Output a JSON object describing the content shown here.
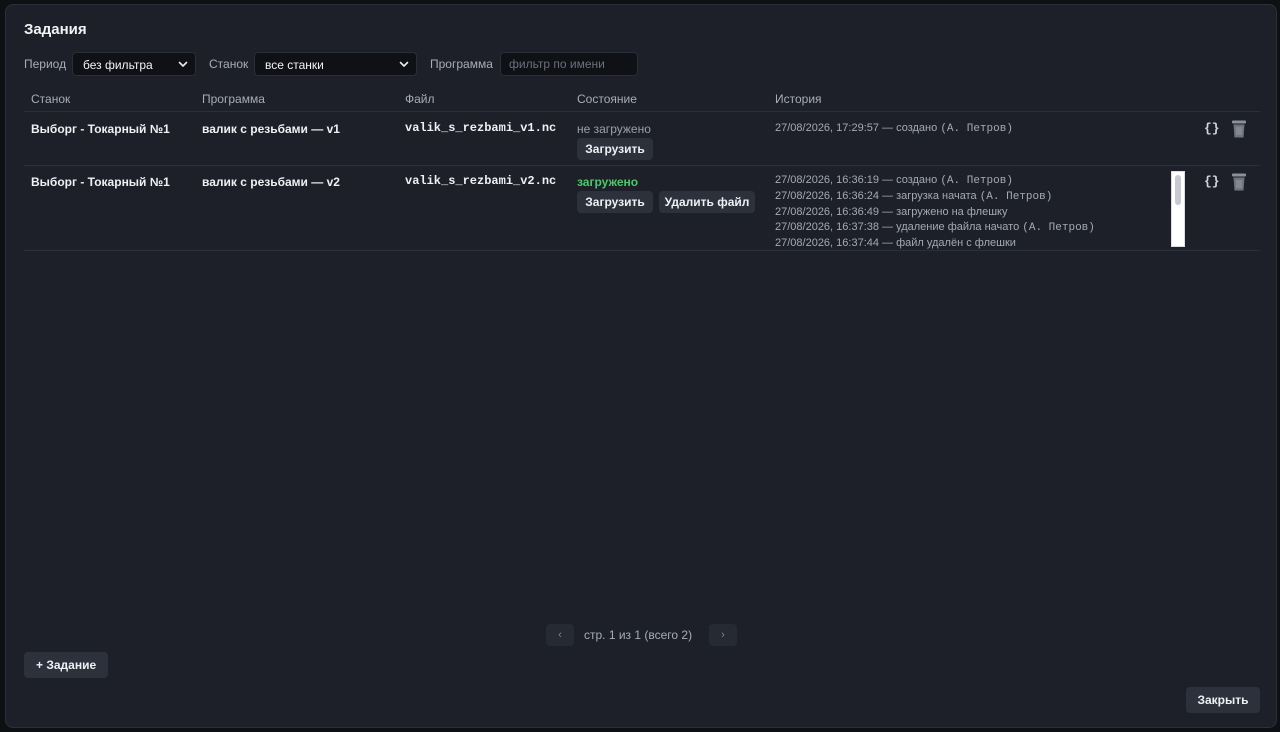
{
  "dialog": {
    "title": "Задания",
    "filters": {
      "period_label": "Период",
      "period_value": "без фильтра",
      "machine_label": "Станок",
      "machine_value": "все станки",
      "program_label": "Программа",
      "program_placeholder": "фильтр по имени",
      "program_value": ""
    },
    "columns": [
      "Станок",
      "Программа",
      "Файл",
      "Состояние",
      "История"
    ],
    "rows": [
      {
        "machine": "Выборг - Токарный №1",
        "program": "валик с резьбами — v1",
        "file": "valik_s_rezbami_v1.nc",
        "status": "не загружено",
        "buttons": [
          "Загрузить"
        ],
        "history": [
          {
            "text": "27/08/2026, 17:29:57 — создано",
            "user": "(А. Петров)"
          }
        ]
      },
      {
        "machine": "Выборг - Токарный №1",
        "program": "валик с резьбами — v2",
        "file": "valik_s_rezbami_v2.nc",
        "status": "загружено",
        "buttons": [
          "Загрузить",
          "Удалить файл"
        ],
        "history": [
          {
            "text": "27/08/2026, 16:36:19 — создано",
            "user": "(А. Петров)"
          },
          {
            "text": "27/08/2026, 16:36:24 — загрузка начата",
            "user": "(А. Петров)"
          },
          {
            "text": "27/08/2026, 16:36:49 — загружено на флешку",
            "user": ""
          },
          {
            "text": "27/08/2026, 16:37:38 — удаление файла начато",
            "user": "(А. Петров)"
          },
          {
            "text": "27/08/2026, 16:37:44 — файл удалён с флешки",
            "user": ""
          }
        ]
      }
    ],
    "row_actions": {
      "json_label": "{}"
    },
    "pagination": {
      "prev": "‹",
      "text": "стр. 1 из 1 (всего 2)",
      "next": "›"
    },
    "add_button": "+ Задание",
    "close_button": "Закрыть"
  },
  "colors": {
    "background": "#1d2028",
    "status_ok": "#4cc86a",
    "button": "#2c313c"
  },
  "icons": [
    "chevron-down-icon",
    "braces-icon",
    "trash-icon",
    "chevron-left-icon",
    "chevron-right-icon"
  ]
}
